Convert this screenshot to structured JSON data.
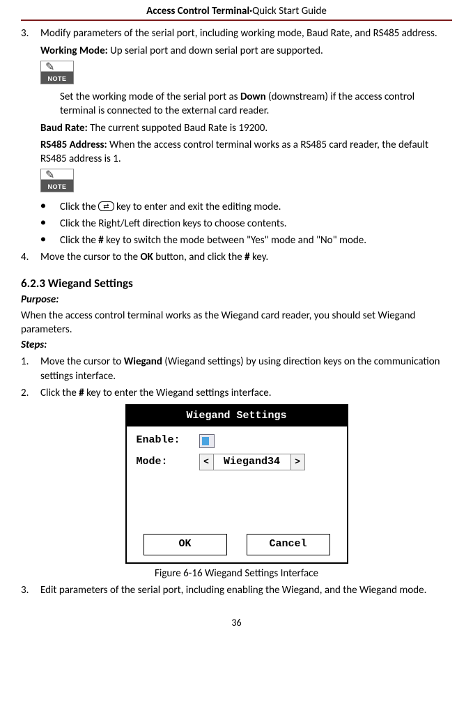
{
  "header": {
    "bold": "Access Control Terminal",
    "sep": "·",
    "light": "Quick Start Guide"
  },
  "step3": {
    "num": "3.",
    "text": "Modify parameters of the serial port, including working mode, Baud Rate, and RS485 address.",
    "working_mode_label": "Working Mode:",
    "working_mode_text": " Up serial port and down serial port are supported.",
    "note1": "Set the working mode of the serial port as ",
    "note1_bold": "Down",
    "note1_after": " (downstream) if the access control terminal is connected to the external card reader.",
    "baud_label": "Baud Rate:",
    "baud_text": " The current suppoted Baud Rate is 19200.",
    "rs485_label": "RS485 Address:",
    "rs485_text": " When the access control terminal works as a RS485 card reader, the default RS485 address is 1."
  },
  "bullets": {
    "b1a": "Click the ",
    "b1_key": "⇄",
    "b1b": " key to enter and exit the editing mode.",
    "b2": "Click the Right/Left direction keys to choose contents.",
    "b3a": "Click the ",
    "b3b": " key to switch the mode between \"Yes\" mode and \"No\" mode.",
    "hash": "#"
  },
  "step4": {
    "num": "4.",
    "a": "Move the cursor to the ",
    "ok": "OK",
    "b": " button, and click the ",
    "hash": "#",
    "c": " key."
  },
  "section": "6.2.3 Wiegand Settings",
  "purpose_label": "Purpose:",
  "purpose_text": "When the access control terminal works as the Wiegand card reader, you should set Wiegand parameters.",
  "steps_label": "Steps:",
  "wstep1": {
    "num": "1.",
    "a": "Move the cursor to ",
    "bold": "Wiegand",
    "b": " (Wiegand settings) by using direction keys on the communication settings interface."
  },
  "wstep2": {
    "num": "2.",
    "a": "Click the ",
    "hash": "#",
    "b": " key to enter the Wiegand settings interface."
  },
  "dialog": {
    "title": "Wiegand Settings",
    "enable_label": "Enable:",
    "mode_label": "Mode:",
    "mode_value": "Wiegand34",
    "left": "<",
    "right": ">",
    "ok": "OK",
    "cancel": "Cancel"
  },
  "caption": "Figure 6-16 Wiegand Settings Interface",
  "wstep3": {
    "num": "3.",
    "text": "Edit parameters of the serial port, including enabling the Wiegand, and the Wiegand mode."
  },
  "page_num": "36"
}
